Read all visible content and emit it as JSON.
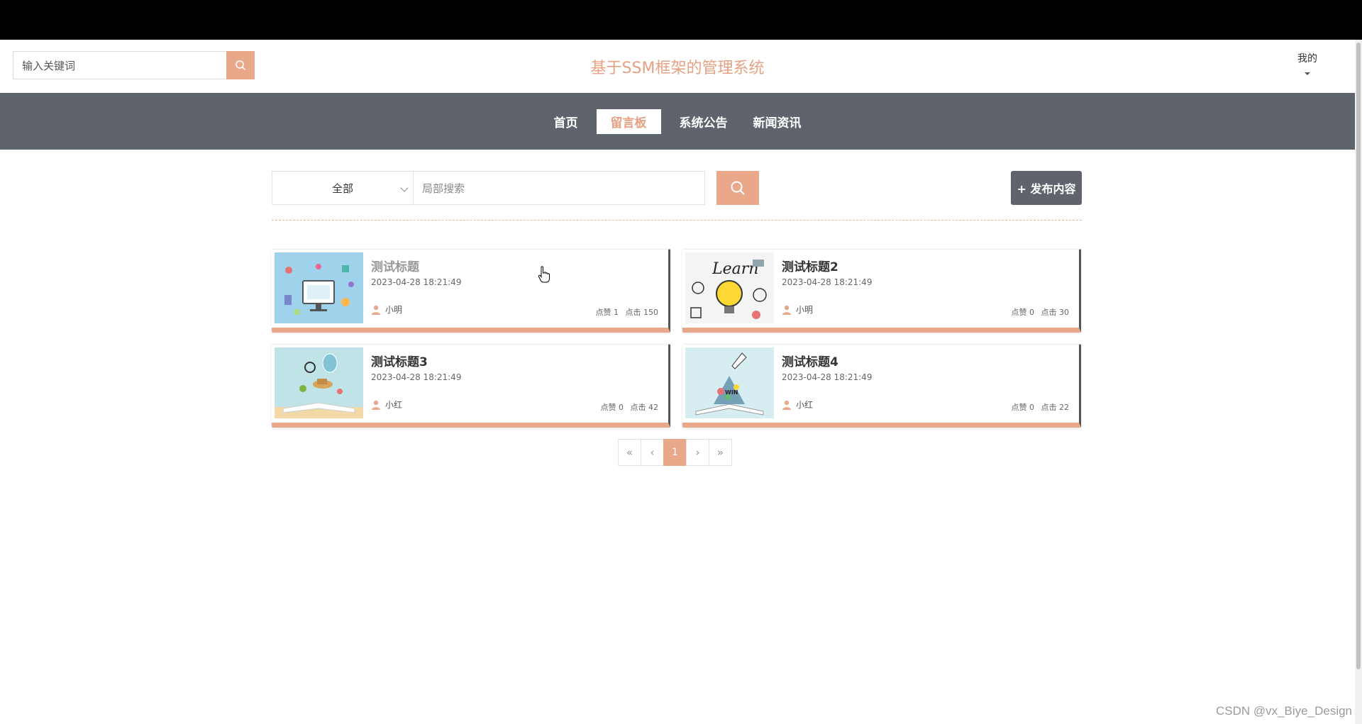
{
  "header": {
    "search_placeholder": "输入关键词",
    "site_title": "基于SSM框架的管理系统",
    "user_menu_label": "我的"
  },
  "nav": {
    "items": [
      {
        "label": "首页",
        "active": false
      },
      {
        "label": "留言板",
        "active": true
      },
      {
        "label": "系统公告",
        "active": false
      },
      {
        "label": "新闻资讯",
        "active": false
      }
    ]
  },
  "filter": {
    "category_selected": "全部",
    "local_search_placeholder": "局部搜索",
    "publish_label": "+ 发布内容"
  },
  "posts": [
    {
      "title": "测试标题",
      "date": "2023-04-28 18:21:49",
      "author": "小明",
      "likes_label": "点赞 1",
      "clicks_label": "点击 150",
      "image": "computer-icons-illustration"
    },
    {
      "title": "测试标题2",
      "date": "2023-04-28 18:21:49",
      "author": "小明",
      "likes_label": "点赞 0",
      "clicks_label": "点击 30",
      "image": "learn-lightbulb-illustration"
    },
    {
      "title": "测试标题3",
      "date": "2023-04-28 18:21:49",
      "author": "小红",
      "likes_label": "点赞 0",
      "clicks_label": "点击 42",
      "image": "open-book-balloon-illustration"
    },
    {
      "title": "测试标题4",
      "date": "2023-04-28 18:21:49",
      "author": "小红",
      "likes_label": "点赞 0",
      "clicks_label": "点击 22",
      "image": "open-book-rocket-illustration"
    }
  ],
  "pagination": {
    "first": "«",
    "prev": "‹",
    "current": "1",
    "next": "›",
    "last": "»"
  },
  "watermark": "CSDN @vx_Biye_Design",
  "colors": {
    "accent": "#e9a88a",
    "nav_bg": "#5f636b",
    "title_color": "#e6a182"
  }
}
